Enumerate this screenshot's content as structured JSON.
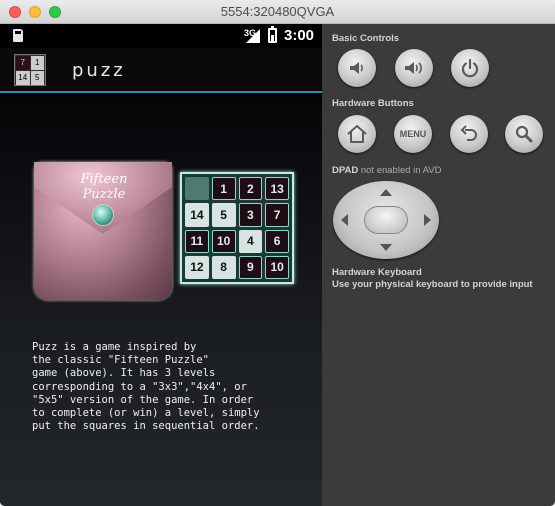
{
  "window": {
    "title": "5554:320480QVGA"
  },
  "status_bar": {
    "network": "3G",
    "time": "3:00"
  },
  "app": {
    "title": "puzz",
    "icon_tiles": [
      "7",
      "1",
      "14",
      "5"
    ]
  },
  "illustration": {
    "pouch_text": "Fifteen Puzzle",
    "tiles": [
      "",
      "1",
      "2",
      "13",
      "14",
      "5",
      "3",
      "7",
      "11",
      "10",
      "4",
      "6",
      "12",
      "8",
      "9",
      "10"
    ]
  },
  "description": "Puzz is a game inspired by\nthe classic \"Fifteen Puzzle\"\ngame (above). It has 3 levels\ncorresponding to a \"3x3\",\"4x4\", or\n\"5x5\" version of the game. In order\nto complete (or win) a level, simply\nput the squares in sequential order.",
  "controls": {
    "basic_controls_label": "Basic Controls",
    "hardware_buttons_label": "Hardware Buttons",
    "menu_label": "MENU",
    "dpad_label": "DPAD",
    "dpad_note": "not enabled in AVD",
    "keyboard_label": "Hardware Keyboard",
    "keyboard_note": "Use your physical keyboard to provide input"
  }
}
